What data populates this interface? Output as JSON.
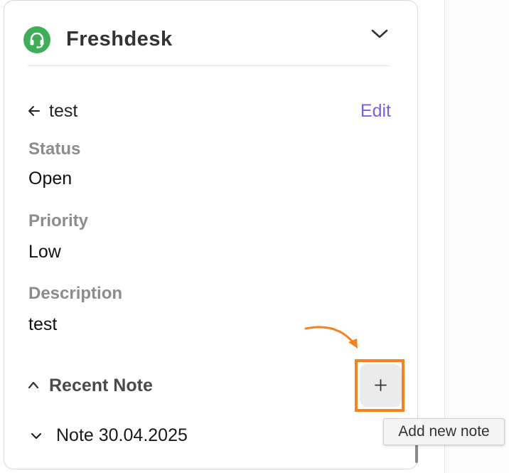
{
  "app": {
    "title": "Freshdesk",
    "brand_color": "#3fae56"
  },
  "ticket": {
    "title": "test",
    "edit_label": "Edit",
    "accent_color": "#7a5cf0"
  },
  "fields": {
    "status": {
      "label": "Status",
      "value": "Open"
    },
    "priority": {
      "label": "Priority",
      "value": "Low"
    },
    "description": {
      "label": "Description",
      "value": "test"
    }
  },
  "notes": {
    "section_title": "Recent Note",
    "add_tooltip": "Add new note",
    "highlight_color": "#f5821f",
    "items": [
      {
        "title": "Note 30.04.2025"
      }
    ]
  },
  "icons": {
    "logo": "headset-icon",
    "header_chevron": "chevron-down-icon",
    "back": "arrow-left-icon",
    "section_toggle": "chevron-up-icon",
    "add": "plus-icon",
    "note_toggle": "chevron-down-icon"
  }
}
